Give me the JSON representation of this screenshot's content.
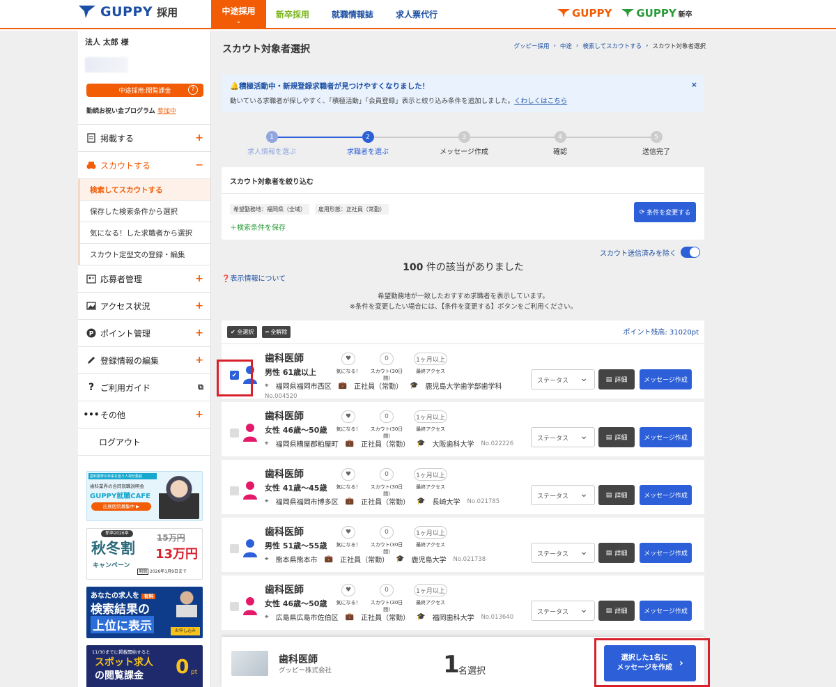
{
  "header": {
    "brand": "GUPPY",
    "brand_sub": "採用",
    "nav": [
      "中途採用",
      "新卒採用",
      "就職情報誌",
      "求人票代行"
    ],
    "right_logo1": "GUPPY",
    "right_logo2": "GUPPY",
    "right_logo2_sub": "新卒"
  },
  "sidebar": {
    "user_name": "法人 太郎 様",
    "plan": "中途採用:閲覧課金",
    "plan_help": "?",
    "program": "勤続お祝い金プログラム",
    "program_link": "参加中",
    "menu": [
      {
        "label": "掲載する",
        "sign": "+"
      },
      {
        "label": "スカウトする",
        "sign": "−"
      }
    ],
    "submenu": [
      "検索してスカウトする",
      "保存した検索条件から選択",
      "気になる！した求職者から選択",
      "スカウト定型文の登録・編集"
    ],
    "menu2": [
      {
        "label": "応募者管理",
        "sign": "+"
      },
      {
        "label": "アクセス状況",
        "sign": "+"
      },
      {
        "label": "ポイント管理",
        "sign": "+"
      },
      {
        "label": "登録情報の編集",
        "sign": "+"
      },
      {
        "label": "ご利用ガイド",
        "sign": "⧉"
      },
      {
        "label": "その他",
        "sign": "+"
      }
    ],
    "logout": "ログアウト",
    "banner1": {
      "line1": "歯科業界の未来を担う人材が集結",
      "line2": "歯科業界の合同就職説明会",
      "title": "GUPPY就職CAFE",
      "cta": "出展医院募集中 ▶"
    },
    "banner2": {
      "tag": "新卒2026卒",
      "title": "秋冬割",
      "sub": "キャンペーン",
      "old_price": "15万円",
      "price": "13万円",
      "period_label": "期間",
      "period": "2026年1月9日まで"
    },
    "banner3": {
      "l1": "あなたの求人を",
      "tag": "有料",
      "l2": "検索結果の",
      "l3": "上位に表示",
      "cta": "お申し込み"
    },
    "banner4": {
      "l1": "11/30までに掲載開始すると",
      "l2": "スポット求人",
      "l3": "の閲覧課金",
      "big": "0",
      "unit": "pt"
    }
  },
  "main": {
    "title": "スカウト対象者選択",
    "breadcrumb": [
      "グッピー採用",
      "中途",
      "検索してスカウトする",
      "スカウト対象者選択"
    ],
    "alert_title": "積極活動中・新規登録求職者が見つけやすくなりました！",
    "alert_desc": "動いている求職者が探しやすく、「積極活動」「会員登録」表示と絞り込み条件を追加しました。",
    "alert_link": "くわしくはこちら",
    "alert_close": "×",
    "steps": [
      "求人情報を選ぶ",
      "求職者を選ぶ",
      "メッセージ作成",
      "確認",
      "送信完了"
    ],
    "step_numbers": [
      "1",
      "2",
      "3",
      "4",
      "5"
    ],
    "filter_title": "スカウト対象者を絞り込む",
    "chips": [
      "希望勤務地：福岡県（全域）",
      "雇用形態：正社員（常勤）"
    ],
    "save_condition": "＋検索条件を保存",
    "change_button": "条件を変更する",
    "toggle_label": "スカウト送信済みを除く",
    "count_num": "100",
    "count_text": " 件の該当がありました",
    "info_link": "表示情報について",
    "note1": "希望勤務地が一致したおすすめ求職者を表示しています。",
    "note2": "※条件を変更したい場合には、【条件を変更する】ボタンをご利用ください。",
    "select_all": "✔ 全選択",
    "deselect_all": "━ 全解除",
    "points": "ポイント残高: 31020pt",
    "card_labels": {
      "like": "気になる！",
      "scout": "スカウト(30日間)",
      "access": "最終アクセス",
      "status": "ステータス",
      "detail": "詳細",
      "message": "メッセージ作成"
    },
    "candidates": [
      {
        "title": "歯科医師",
        "gender_age": "男性 61歳以上",
        "location": "福岡県福岡市西区",
        "employment": "正社員（常勤）",
        "school": "鹿児島大学歯学部歯学科",
        "no": "No.004520",
        "scout_count": "0",
        "last_access": "1ヶ月以上",
        "checked": true,
        "gender": "male"
      },
      {
        "title": "歯科医師",
        "gender_age": "女性 46歳〜50歳",
        "location": "福岡県糟屋郡粕屋町",
        "employment": "正社員（常勤）",
        "school": "大阪歯科大学",
        "no": "No.022226",
        "scout_count": "0",
        "last_access": "1ヶ月以上",
        "checked": false,
        "gender": "female"
      },
      {
        "title": "歯科医師",
        "gender_age": "女性 41歳〜45歳",
        "location": "福岡県福岡市博多区",
        "employment": "正社員（常勤）",
        "school": "長崎大学",
        "no": "No.021785",
        "scout_count": "0",
        "last_access": "1ヶ月以上",
        "checked": false,
        "gender": "female"
      },
      {
        "title": "歯科医師",
        "gender_age": "男性 51歳〜55歳",
        "location": "熊本県熊本市",
        "employment": "正社員（常勤）",
        "school": "鹿児島大学",
        "no": "No.021738",
        "scout_count": "0",
        "last_access": "1ヶ月以上",
        "checked": false,
        "gender": "male"
      },
      {
        "title": "歯科医師",
        "gender_age": "女性 46歳〜50歳",
        "location": "広島県広島市佐伯区",
        "employment": "正社員（常勤）",
        "school": "福岡歯科大学",
        "no": "No.013640",
        "scout_count": "0",
        "last_access": "1ヶ月以上",
        "checked": false,
        "gender": "female"
      }
    ],
    "bottom": {
      "job_title": "歯科医師",
      "company": "グッピー株式会社",
      "count": "1",
      "unit": "名選択",
      "send_l1": "選択した1名に",
      "send_l2": "メッセージを作成"
    }
  },
  "colors": {
    "brand_orange": "#f25c05",
    "brand_blue": "#1c4fa3",
    "button_blue": "#2c5fd8",
    "highlight_red": "#d8202c",
    "male": "#2c5fd8",
    "female": "#e5196a"
  }
}
